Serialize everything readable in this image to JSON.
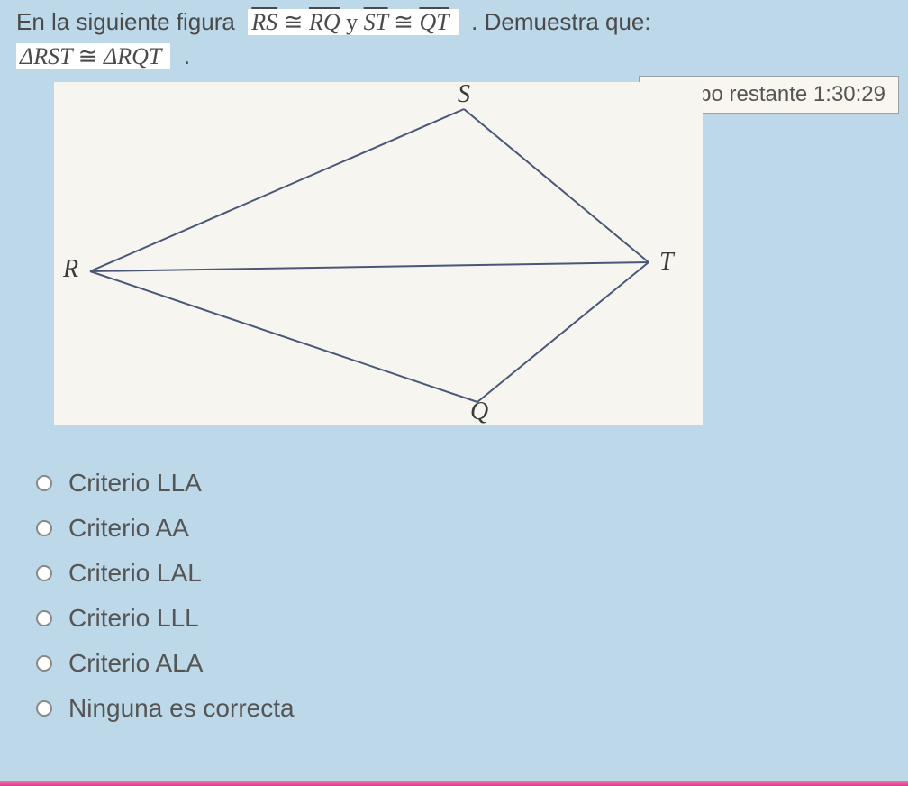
{
  "question": {
    "lead": "En la siguiente figura",
    "given_rs": "RS",
    "congr": "≅",
    "given_rq": "RQ",
    "and": "y",
    "given_st": "ST",
    "given_qt": "QT",
    "tail": ". Demuestra que:",
    "prove_tri1": "ΔRST",
    "prove_tri2": "ΔRQT",
    "period": "."
  },
  "timer": {
    "label": "Tiempo restante",
    "value": "1:30:29"
  },
  "figure": {
    "labels": {
      "R": "R",
      "S": "S",
      "T": "T",
      "Q": "Q"
    }
  },
  "options": [
    {
      "label": "Criterio LLA"
    },
    {
      "label": "Criterio AA"
    },
    {
      "label": "Criterio LAL"
    },
    {
      "label": "Criterio LLL"
    },
    {
      "label": "Criterio ALA"
    },
    {
      "label": "Ninguna es correcta"
    }
  ]
}
